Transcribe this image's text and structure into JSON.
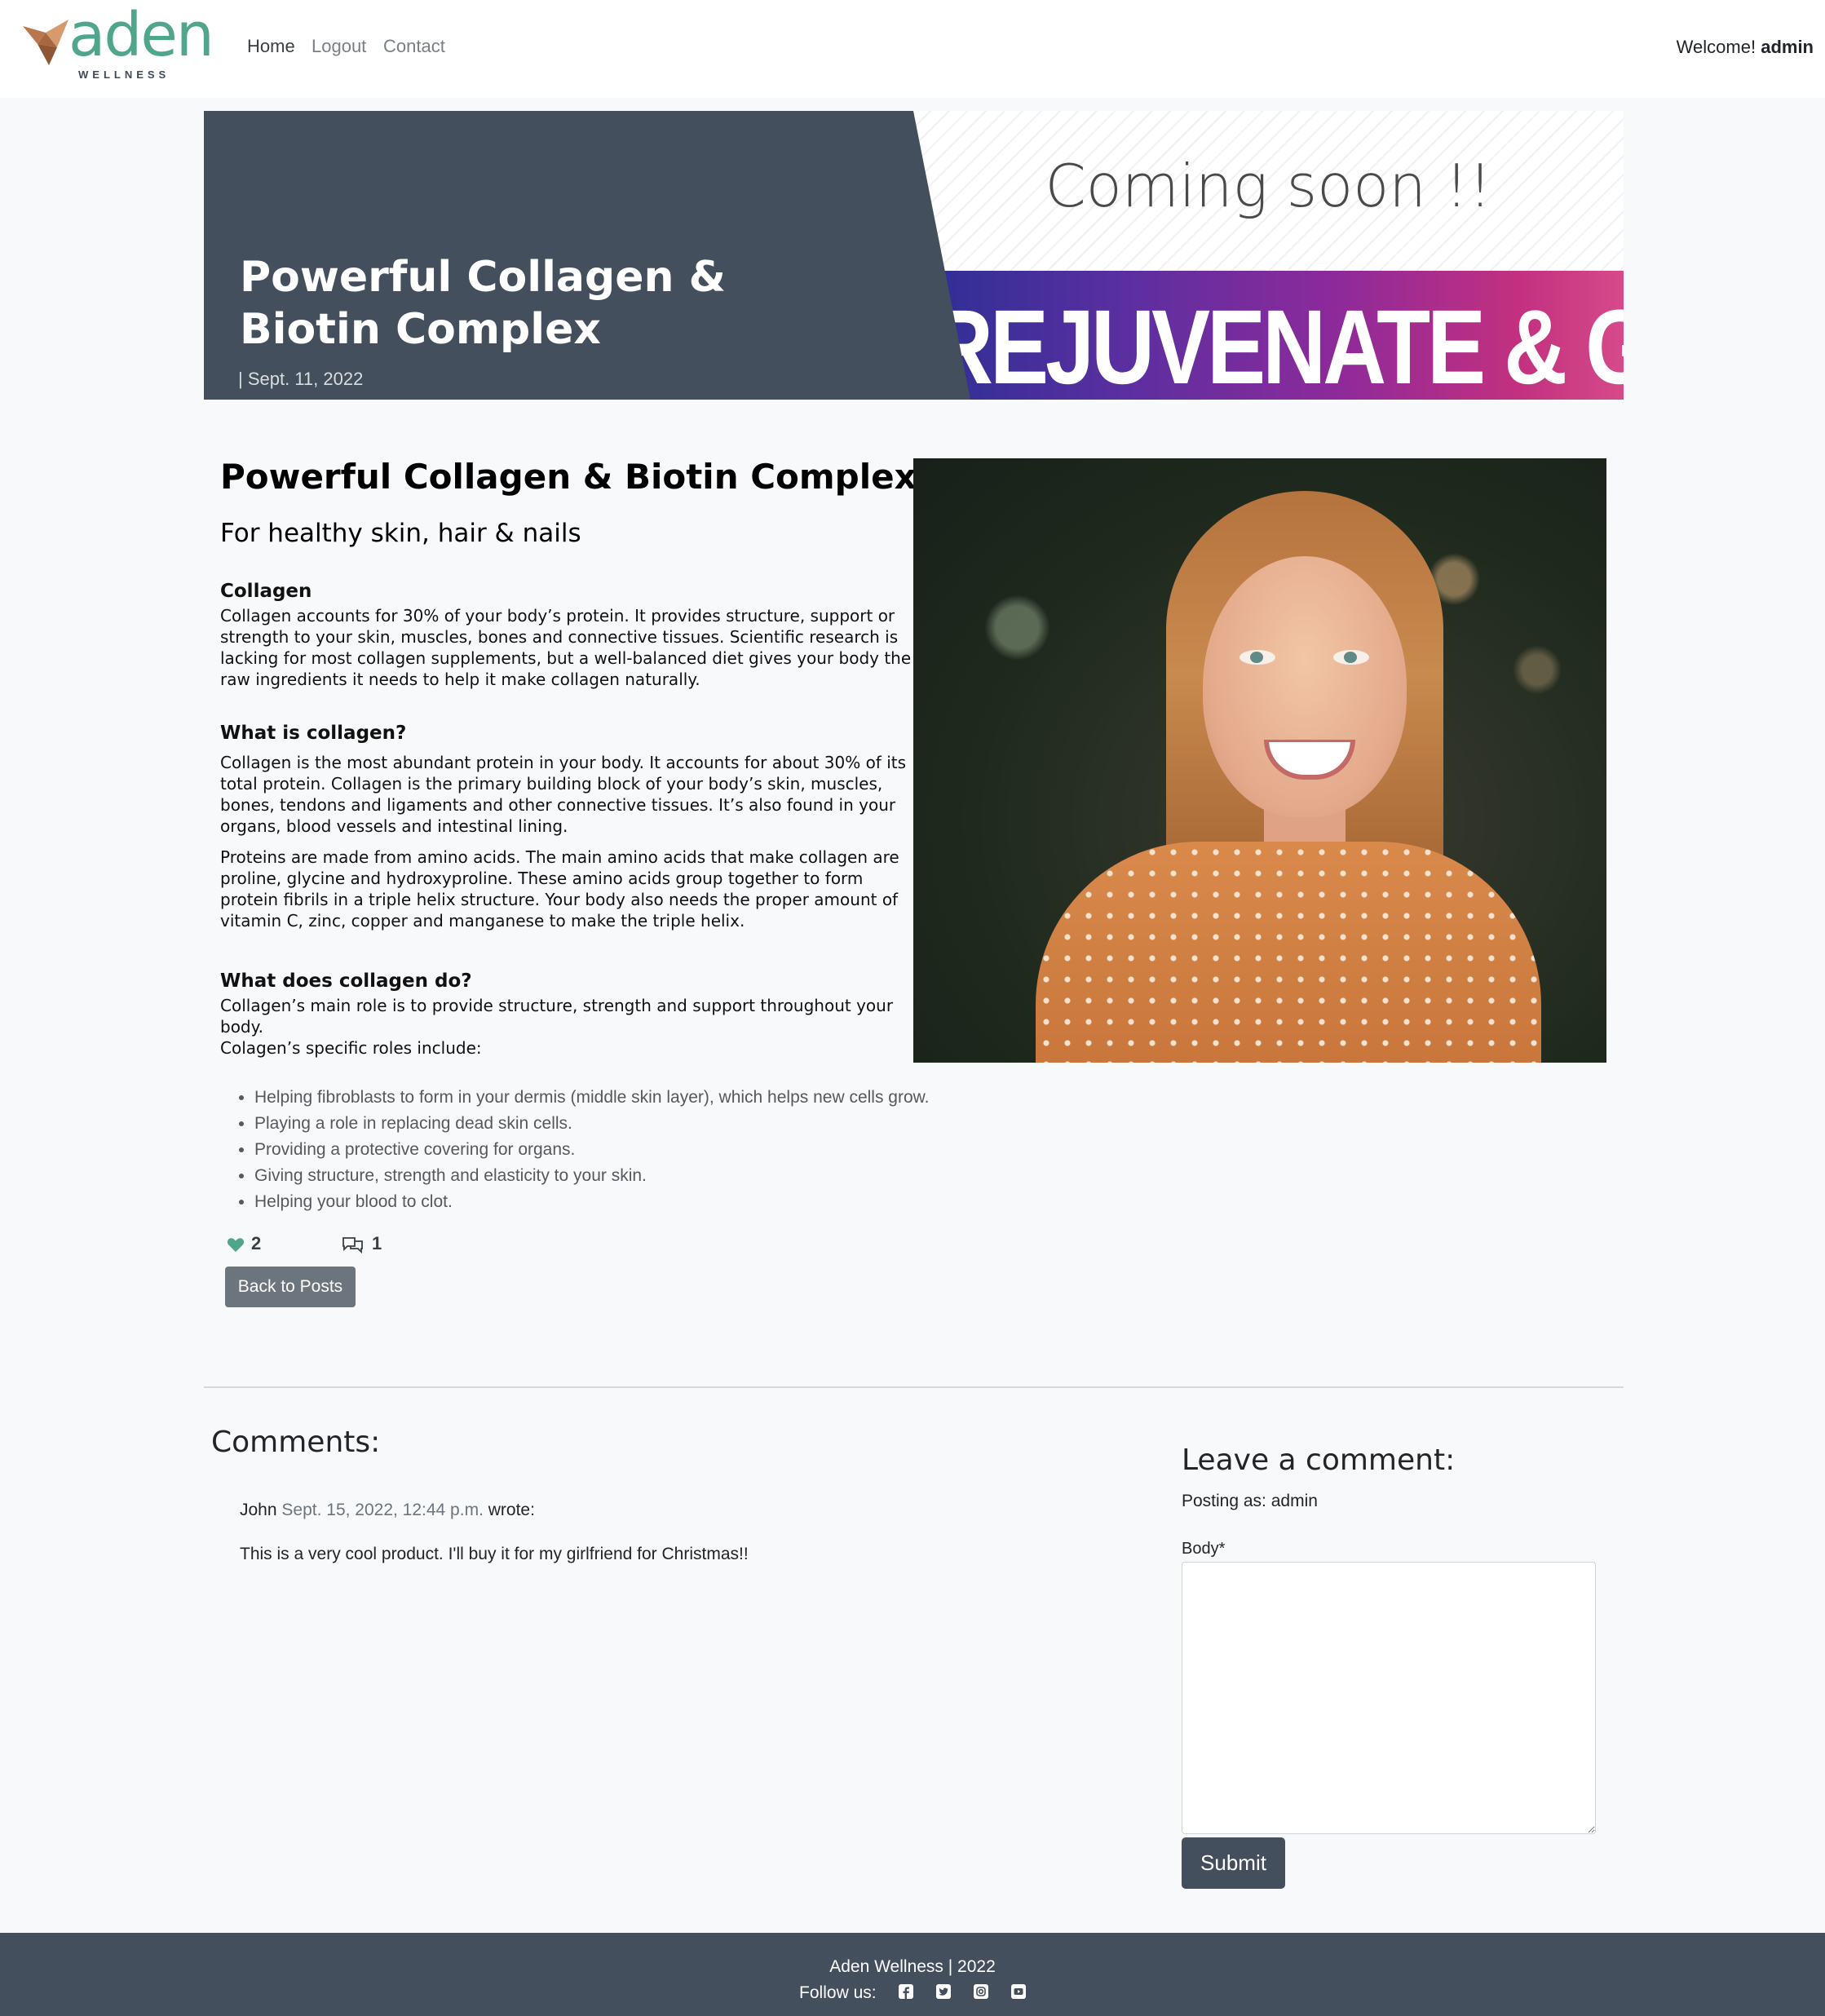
{
  "nav": {
    "logo_word": "aden",
    "logo_sub": "WELLNESS",
    "links": [
      "Home",
      "Logout",
      "Contact"
    ],
    "welcome_prefix": "Welcome!",
    "username": "admin"
  },
  "hero": {
    "title": "Powerful Collagen & Biotin Complex",
    "date": "| Sept. 11, 2022",
    "banner_top": "Coming soon !!",
    "banner_bottom": "REJUVENATE & GLOW"
  },
  "article": {
    "title": "Powerful Collagen & Biotin Complex",
    "subtitle": "For healthy skin, hair & nails",
    "sections": [
      {
        "heading": "Collagen",
        "paragraphs": [
          "Collagen accounts for 30% of your body’s protein. It provides structure, support or strength to your skin, muscles, bones and connective tissues. Scientific research is lacking for most collagen supplements, but a well-balanced diet gives your body the raw ingredients it needs to help it make collagen naturally."
        ]
      },
      {
        "heading": "What is collagen?",
        "paragraphs": [
          "Collagen is the most abundant protein in your body. It accounts for about 30% of its total protein. Collagen is the primary building block of your body’s skin, muscles, bones, tendons and ligaments and other connective tissues. It’s also found in your organs, blood vessels and intestinal lining.",
          "Proteins are made from amino acids. The main amino acids that make collagen are proline, glycine and hydroxyproline. These amino acids group together to form protein fibrils in a triple helix structure. Your body also needs the proper amount of vitamin C, zinc, copper and manganese to make the triple helix."
        ]
      },
      {
        "heading": "What does collagen do?",
        "paragraphs": [
          "Collagen’s main role is to provide structure, strength and support throughout your body.",
          "Colagen’s specific roles include:"
        ]
      }
    ],
    "bullets": [
      "Helping fibroblasts to form in your dermis (middle skin layer), which helps new cells grow.",
      "Playing a role in replacing dead skin cells.",
      "Providing a protective covering for organs.",
      "Giving structure, strength and elasticity to your skin.",
      "Helping your blood to clot."
    ],
    "likes": "2",
    "comment_count": "1",
    "back_label": "Back to Posts"
  },
  "comments": {
    "title": "Comments:",
    "items": [
      {
        "author": "John",
        "date": "Sept. 15, 2022, 12:44 p.m.",
        "wrote": "wrote:",
        "body": "This is a very cool product. I'll buy it for my girlfriend for Christmas!!"
      }
    ]
  },
  "form": {
    "title": "Leave a comment:",
    "posting_as": "Posting as: admin",
    "body_label": "Body*",
    "body_value": "",
    "submit_label": "Submit"
  },
  "footer": {
    "line1": "Aden Wellness | 2022",
    "follow": "Follow us:",
    "social_icons": [
      "facebook-icon",
      "twitter-icon",
      "instagram-icon",
      "youtube-icon"
    ]
  },
  "colors": {
    "brand_green": "#4fa68d",
    "slate": "#434f5d",
    "button_grey": "#6c757d"
  }
}
